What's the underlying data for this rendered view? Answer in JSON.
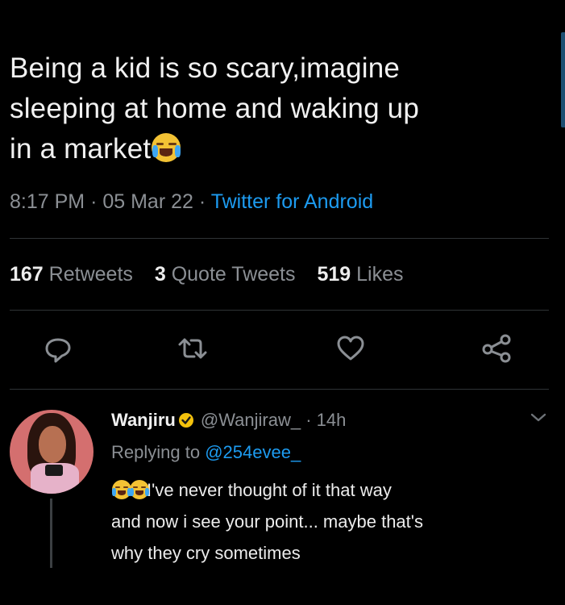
{
  "tweet": {
    "text_line1": "Being a kid is so scary,imagine",
    "text_line2": "sleeping at home and waking up",
    "text_line3": "in a market",
    "emoji": "loudly-crying-face",
    "time": "8:17 PM",
    "date": "05 Mar 22",
    "separator": "·",
    "source": "Twitter for Android"
  },
  "stats": {
    "retweets_count": "167",
    "retweets_label": "Retweets",
    "quotes_count": "3",
    "quotes_label": "Quote Tweets",
    "likes_count": "519",
    "likes_label": "Likes"
  },
  "actions": {
    "reply_icon": "speech-bubble-icon",
    "retweet_icon": "retweet-icon",
    "like_icon": "heart-icon",
    "share_icon": "share-icon"
  },
  "reply": {
    "name": "Wanjiru",
    "handle": "@Wanjiraw_",
    "time": "14h",
    "replying_prefix": "Replying to",
    "replying_to": "@254evee_",
    "text_line1": "I've never thought of it that way",
    "text_line2": "and now i see your point... maybe that's",
    "text_line3": "why they cry sometimes",
    "leading_emoji": "face-with-tears-of-joy"
  },
  "colors": {
    "background": "#000000",
    "text": "#e7e9ea",
    "muted": "#8b8f94",
    "accent": "#1d9bf0",
    "badge": "#f4c20d"
  }
}
